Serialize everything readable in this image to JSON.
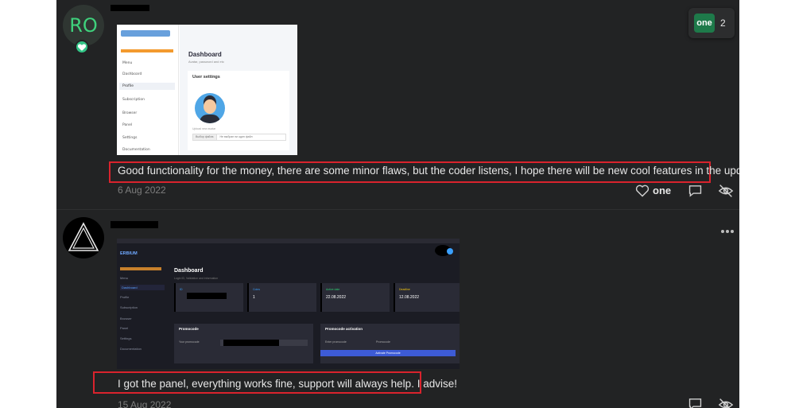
{
  "reaction": {
    "label": "one",
    "count": "2"
  },
  "comments": [
    {
      "avatar_initials": "RO",
      "text": "Good functionality for the money, there are some minor flaws, but the coder listens, I hope there will be new cool features in the update in the future",
      "date": "6 Aug 2022",
      "like_count": "one",
      "screenshot": {
        "nav_menu_heading": "Menu",
        "nav": [
          "Dashboard",
          "Profile",
          "Subscription"
        ],
        "nav_section_heading": "Browser",
        "nav2": [
          "Panel",
          "Settings",
          "Documentation"
        ],
        "title": "Dashboard",
        "subtitle": "Avatar, password and etc",
        "card_title": "User settings",
        "upload_label": "Upload new avatar",
        "file_button": "Выбор файла",
        "file_status": "Не выбран ни один файл"
      }
    },
    {
      "text": "I got the panel, everything works fine, support will always help. I advise!",
      "date": "15 Aug 2022",
      "screenshot": {
        "logo": "ERBIUM",
        "nav_menu_heading": "Menu",
        "nav": [
          "Dashboard",
          "Profile",
          "Subscription"
        ],
        "nav_section_heading": "Browser",
        "nav2": [
          "Panel",
          "Settings",
          "Documentation"
        ],
        "title": "Dashboard",
        "subtitle": "Login ID, Validation and information",
        "stats": [
          {
            "label": "ID",
            "value": "",
            "color": "#3aa0ff"
          },
          {
            "label": "Coins",
            "value": "1",
            "color": "#3aa0ff"
          },
          {
            "label": "Active date",
            "value": "22.08.2022",
            "color": "#2ecc71"
          },
          {
            "label": "Deadline",
            "value": "12.08.2022",
            "color": "#f1c40f"
          }
        ],
        "promo_title": "Promocode",
        "promo_field": "Your promocode",
        "activation_title": "Promocode activation",
        "activation_field": "Enter promocode",
        "activation_input": "Promocode",
        "activation_button": "Activate Promocode"
      }
    }
  ],
  "colors": {
    "highlight": "#d9232d",
    "panel": "#222324",
    "accent": "#32c486"
  }
}
